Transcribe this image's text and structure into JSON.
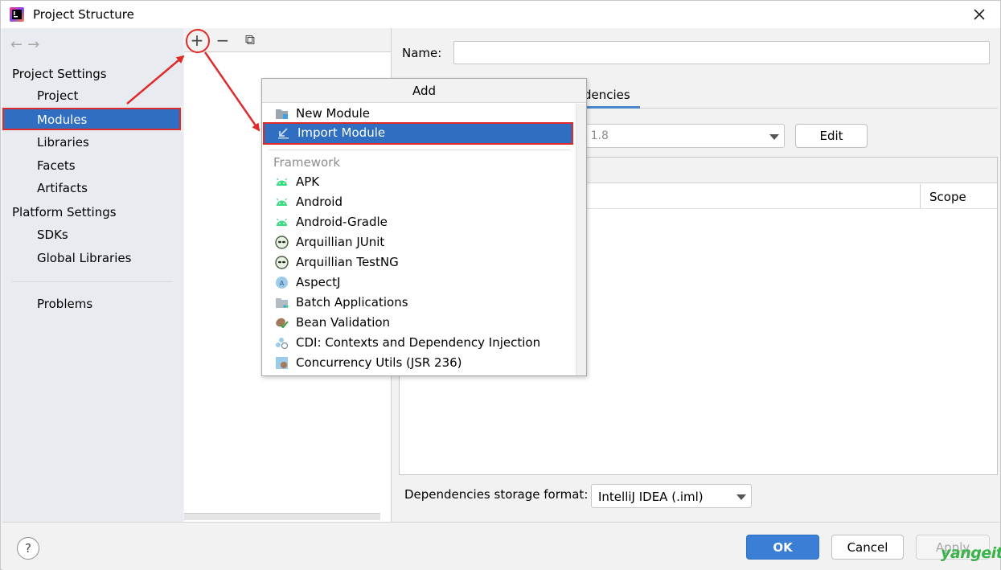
{
  "window": {
    "title": "Project Structure"
  },
  "sidebar": {
    "nav": {
      "back": "←",
      "forward": "→"
    },
    "groups": [
      {
        "label": "Project Settings",
        "items": [
          "Project",
          "Modules",
          "Libraries",
          "Facets",
          "Artifacts"
        ]
      },
      {
        "label": "Platform Settings",
        "items": [
          "SDKs",
          "Global Libraries"
        ]
      }
    ],
    "problems": "Problems",
    "selected": "Modules"
  },
  "toolbar": {
    "add": "+",
    "remove": "−",
    "copy": "⧉"
  },
  "details": {
    "name_label": "Name:",
    "name_value": "",
    "visible_tab_text": "dencies",
    "sdk_value_visible": "K 1.8",
    "edit_button": "Edit",
    "scope_header": "Scope",
    "storage_label": "Dependencies storage format:",
    "storage_value": "IntelliJ IDEA (.iml)"
  },
  "popup": {
    "title": "Add",
    "top_items": [
      {
        "label": "New Module",
        "icon": "folder-module-icon"
      },
      {
        "label": "Import Module",
        "icon": "import-arrow-icon",
        "selected": true
      }
    ],
    "group_label": "Framework",
    "framework_items": [
      {
        "label": "APK",
        "icon": "android-icon"
      },
      {
        "label": "Android",
        "icon": "android-icon"
      },
      {
        "label": "Android-Gradle",
        "icon": "android-icon"
      },
      {
        "label": "Arquillian JUnit",
        "icon": "alien-icon"
      },
      {
        "label": "Arquillian TestNG",
        "icon": "alien-icon"
      },
      {
        "label": "AspectJ",
        "icon": "aspectj-icon"
      },
      {
        "label": "Batch Applications",
        "icon": "batch-folder-icon"
      },
      {
        "label": "Bean Validation",
        "icon": "bean-check-icon"
      },
      {
        "label": "CDI: Contexts and Dependency Injection",
        "icon": "cdi-icon"
      },
      {
        "label": "Concurrency Utils (JSR 236)",
        "icon": "concurrency-icon"
      }
    ]
  },
  "footer": {
    "help": "?",
    "ok": "OK",
    "cancel": "Cancel",
    "apply": "Apply"
  },
  "watermark": "yangeit",
  "colors": {
    "accent": "#2f6ec1",
    "annotation": "#e02b2b",
    "android": "#3ddc84"
  }
}
